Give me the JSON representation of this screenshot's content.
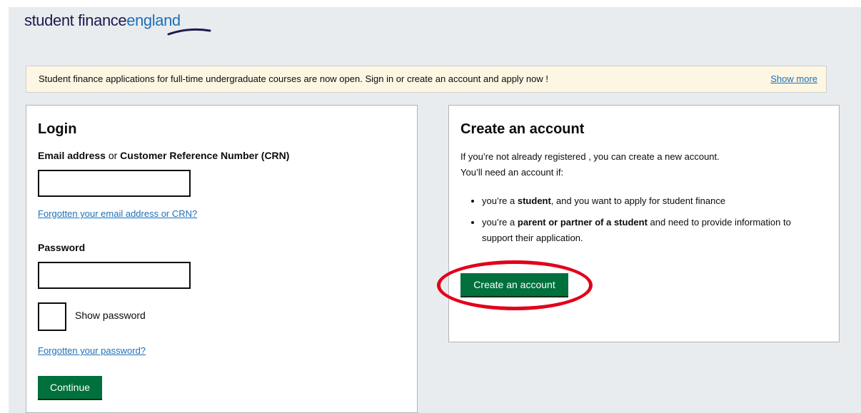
{
  "logo": {
    "part1": "student finance",
    "part2": "england"
  },
  "banner": {
    "message": "Student finance applications for full-time undergraduate courses are now open. Sign in or create an account and apply now !",
    "show_more": "Show more"
  },
  "login": {
    "title": "Login",
    "email_label_bold1": "Email address",
    "email_label_or": " or ",
    "email_label_bold2": "Customer Reference Number (CRN)",
    "email_value": "",
    "forgot_email": "Forgotten your email address or CRN?",
    "password_label": "Password",
    "password_value": "",
    "show_password": "Show password",
    "forgot_password": "Forgotten your password?",
    "continue_label": "Continue"
  },
  "create": {
    "title": "Create an account",
    "intro1": "If you’re not already registered , you can create a new account.",
    "intro2": "You’ll need an account if:",
    "bullet1_pre": "you’re a ",
    "bullet1_bold": "student",
    "bullet1_post": ", and you want to apply for student finance",
    "bullet2_pre": "you’re a ",
    "bullet2_bold": "parent or partner of a student",
    "bullet2_post": " and need to provide information to support their application.",
    "button_label": "Create an account"
  },
  "colors": {
    "brand_green": "#00703c",
    "link_blue": "#1d70b8",
    "highlight_red": "#e2001a"
  }
}
